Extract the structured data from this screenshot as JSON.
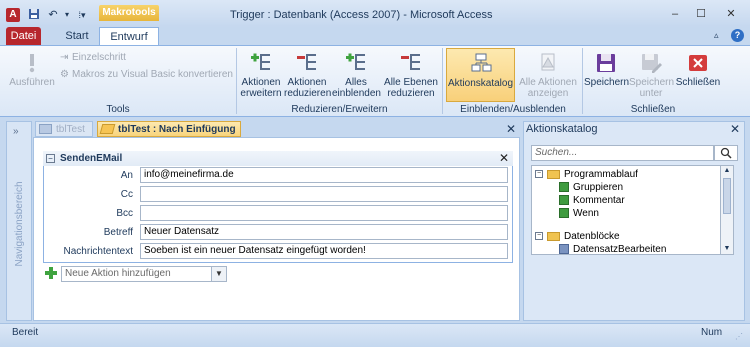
{
  "window": {
    "title": "Trigger : Datenbank (Access 2007)  -  Microsoft Access",
    "context_tab": "Makrotools",
    "min": "–",
    "max": "☐",
    "close": "✕"
  },
  "tabs": {
    "file": "Datei",
    "start": "Start",
    "design": "Entwurf"
  },
  "ribbon": {
    "tools": {
      "run": "Ausführen",
      "single_step": "Einzelschritt",
      "convert": "Makros zu Visual Basic konvertieren",
      "label": "Tools"
    },
    "expand": {
      "expand_actions_line1": "Aktionen",
      "expand_actions_line2": "erweitern",
      "reduce_actions_line1": "Aktionen",
      "reduce_actions_line2": "reduzieren",
      "show_all_line1": "Alles",
      "show_all_line2": "einblenden",
      "reduce_all_line1": "Alle Ebenen",
      "reduce_all_line2": "reduzieren",
      "label": "Reduzieren/Erweitern"
    },
    "showhide": {
      "catalog": "Aktionskatalog",
      "show_all_actions_line1": "Alle Aktionen",
      "show_all_actions_line2": "anzeigen",
      "label": "Einblenden/Ausblenden"
    },
    "close": {
      "save": "Speichern",
      "save_as_line1": "Speichern",
      "save_as_line2": "unter",
      "close": "Schließen",
      "label": "Schließen"
    }
  },
  "nav_pane": {
    "label": "Navigationsbereich",
    "toggle": "»"
  },
  "doc_tabs": {
    "tab1": "tblTest",
    "tab2": "tblTest : Nach Einfügung :",
    "close": "✕"
  },
  "macro_block": {
    "title": "SendenEMail",
    "fields": [
      {
        "label": "An",
        "value": "info@meinefirma.de"
      },
      {
        "label": "Cc",
        "value": ""
      },
      {
        "label": "Bcc",
        "value": ""
      },
      {
        "label": "Betreff",
        "value": "Neuer Datensatz"
      },
      {
        "label": "Nachrichtentext",
        "value": "Soeben ist ein neuer Datensatz eingefügt worden!"
      }
    ],
    "add_action_placeholder": "Neue Aktion hinzufügen"
  },
  "catalog": {
    "title": "Aktionskatalog",
    "search_placeholder": "Suchen...",
    "tree": {
      "group1": "Programmablauf",
      "items1": [
        "Gruppieren",
        "Kommentar",
        "Wenn"
      ],
      "group2": "Datenblöcke",
      "items2": [
        "DatensatzBearbeiten"
      ]
    }
  },
  "status": {
    "left": "Bereit",
    "right": "Num"
  },
  "colors": {
    "accent": "#b7272d",
    "context_tab": "#e8b53a",
    "ribbon_border": "#8db2e3",
    "frame": "#c5d8ef"
  },
  "icons": [
    "app-icon",
    "save-icon",
    "undo-icon",
    "help-icon",
    "run-icon",
    "step-icon",
    "convert-icon",
    "plus-icon",
    "minus-icon",
    "catalog-icon",
    "floppy-icon",
    "close-red-icon",
    "folder-icon",
    "green-action-icon",
    "search-icon"
  ]
}
